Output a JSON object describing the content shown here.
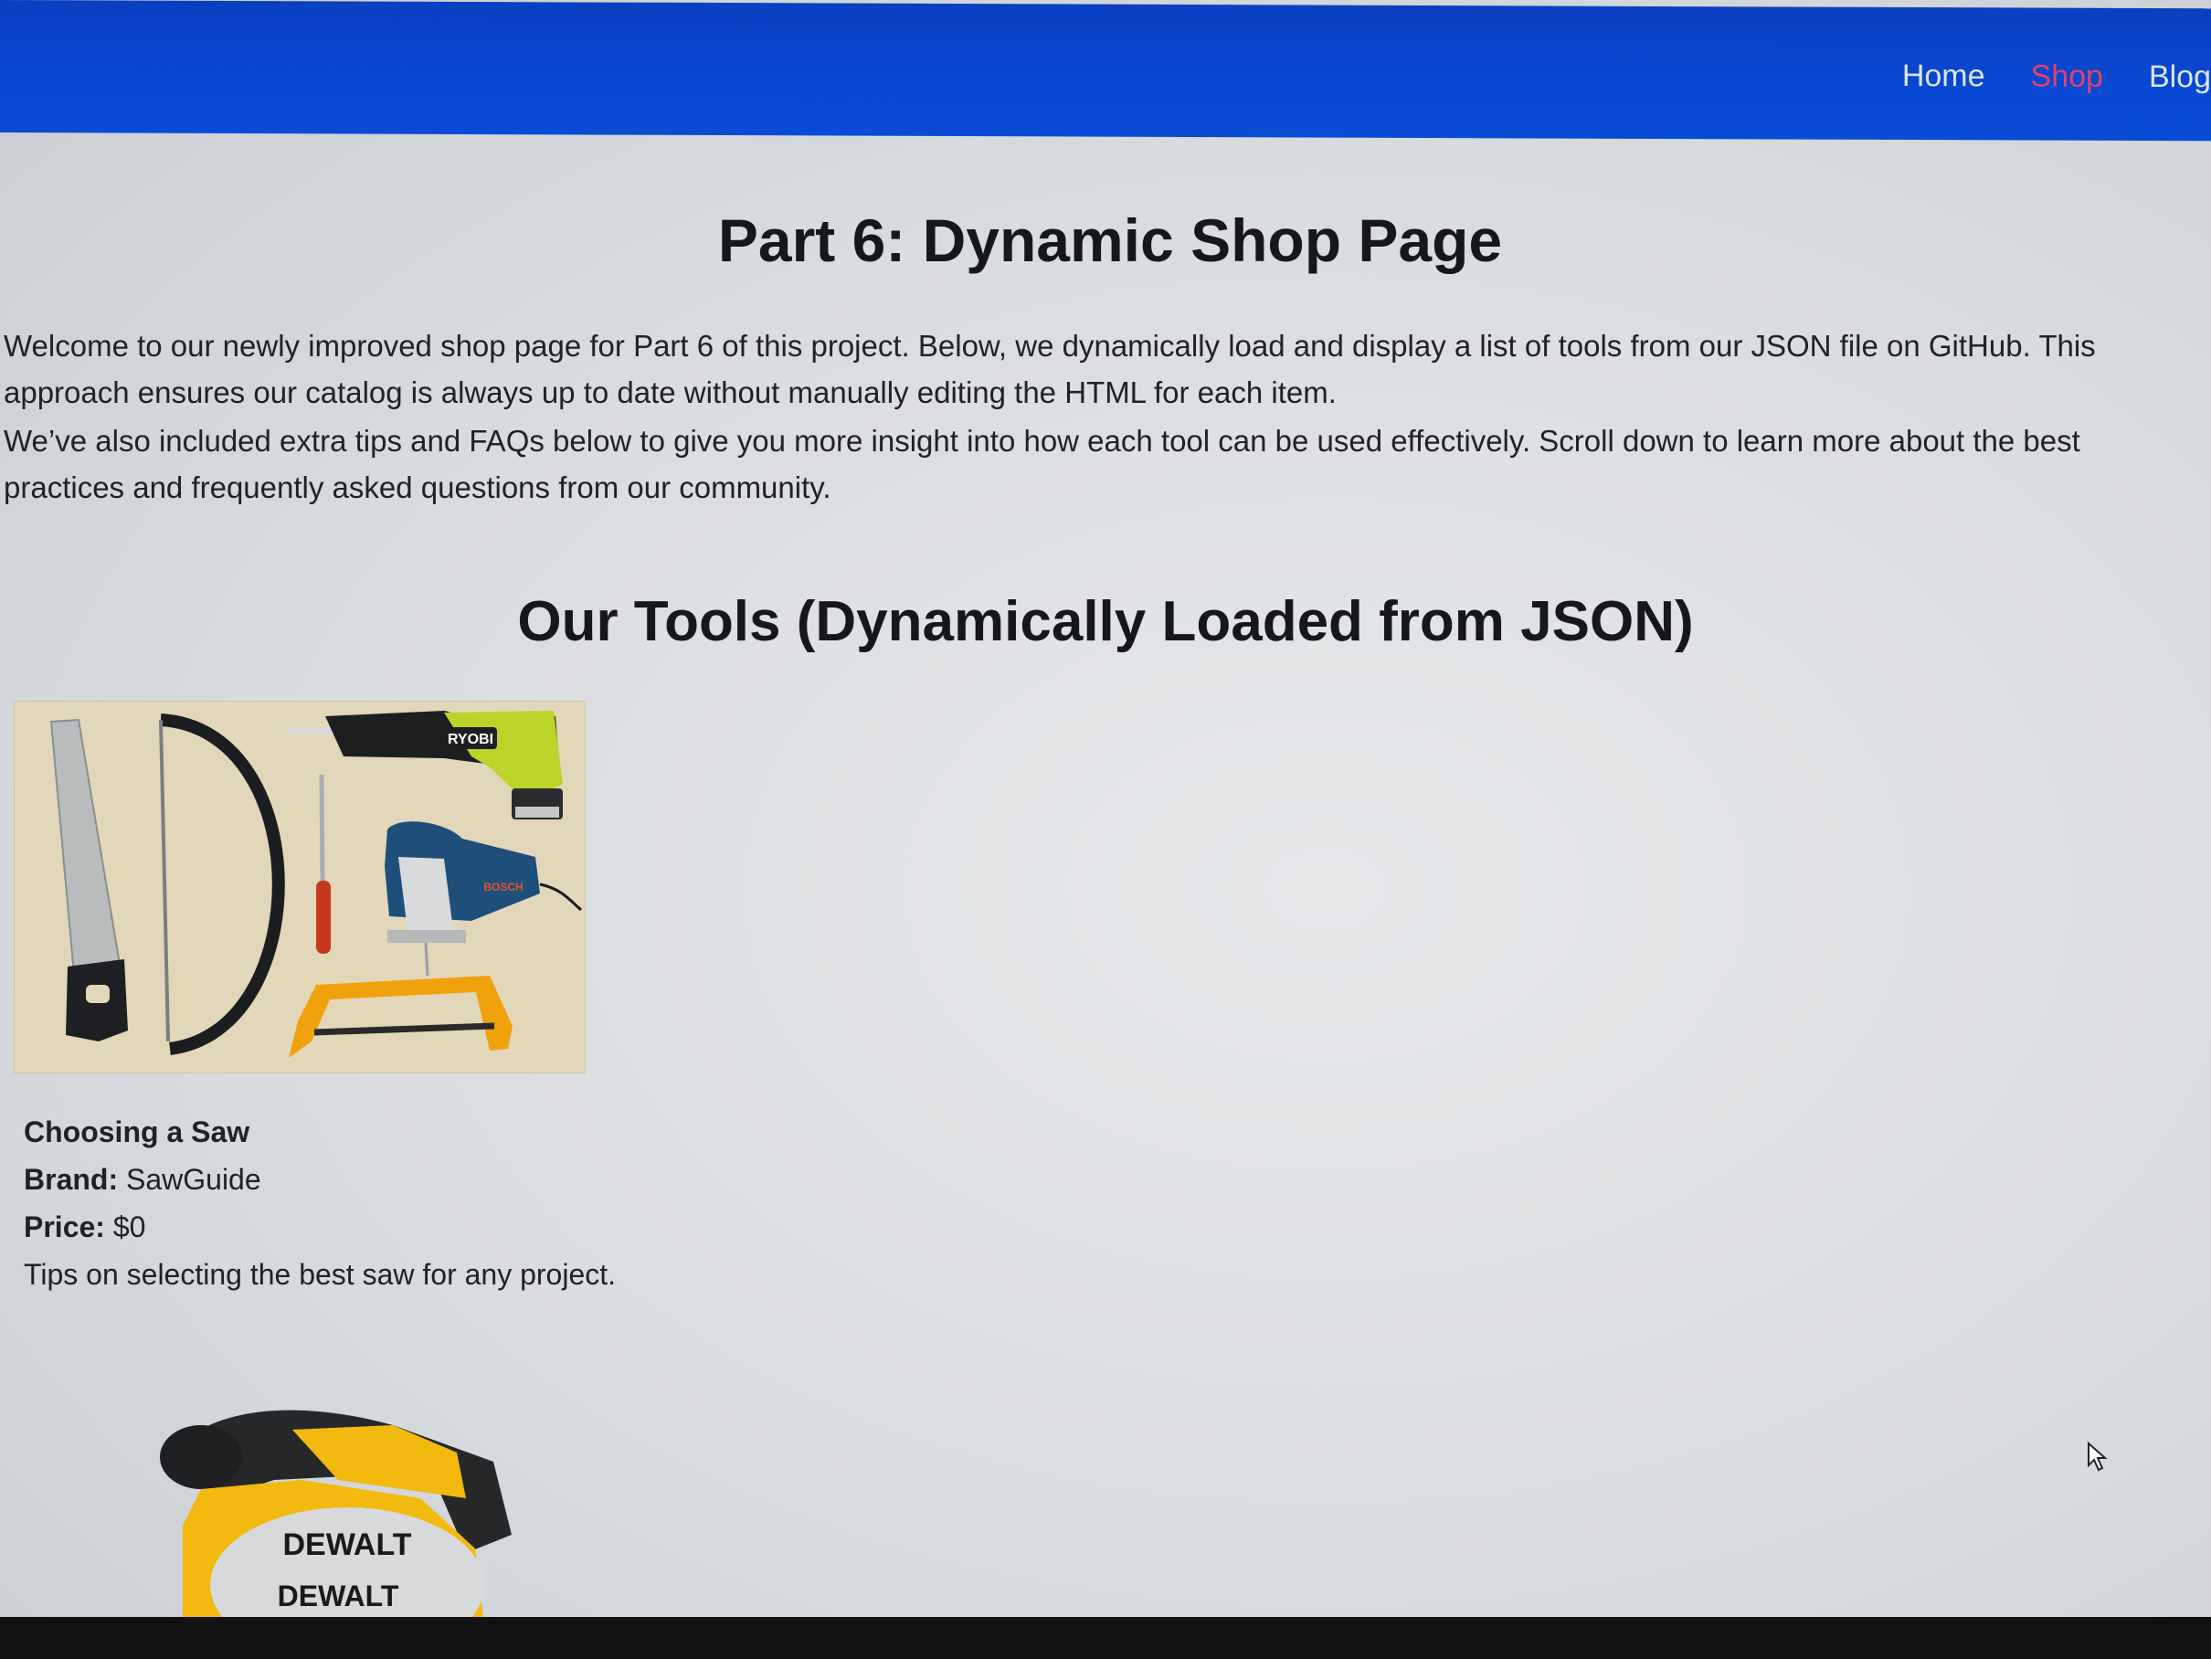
{
  "nav": {
    "items": [
      {
        "label": "Home"
      },
      {
        "label": "Shop"
      },
      {
        "label": "Blog"
      }
    ],
    "active": "Shop"
  },
  "page": {
    "title": "Part 6: Dynamic Shop Page",
    "intro_1": "Welcome to our newly improved shop page for Part 6 of this project. Below, we dynamically load and display a list of tools from our JSON file on GitHub. This approach ensures our catalog is always up to date without manually editing the HTML for each item.",
    "intro_2": "We’ve also included extra tips and FAQs below to give you more insight into how each tool can be used effectively. Scroll down to learn more about the best practices and frequently asked questions from our community.",
    "section_title": "Our Tools (Dynamically Loaded from JSON)"
  },
  "products": [
    {
      "name": "Choosing a Saw",
      "brand_label": "Brand:",
      "brand": "SawGuide",
      "price_label": "Price:",
      "price": "$0",
      "description": "Tips on selecting the best saw for any project.",
      "image_labels": {
        "drill": "RYOBI",
        "jigsaw": "BOSCH"
      }
    },
    {
      "image_labels": {
        "brand_top": "DEWALT",
        "brand_bottom": "DEWALT"
      }
    }
  ],
  "colors": {
    "nav_bg": "#0848d2",
    "nav_link": "#dbe4ff",
    "nav_active": "#e0426b",
    "page_bg": "#dfe2e5",
    "text": "#1e1f24"
  }
}
